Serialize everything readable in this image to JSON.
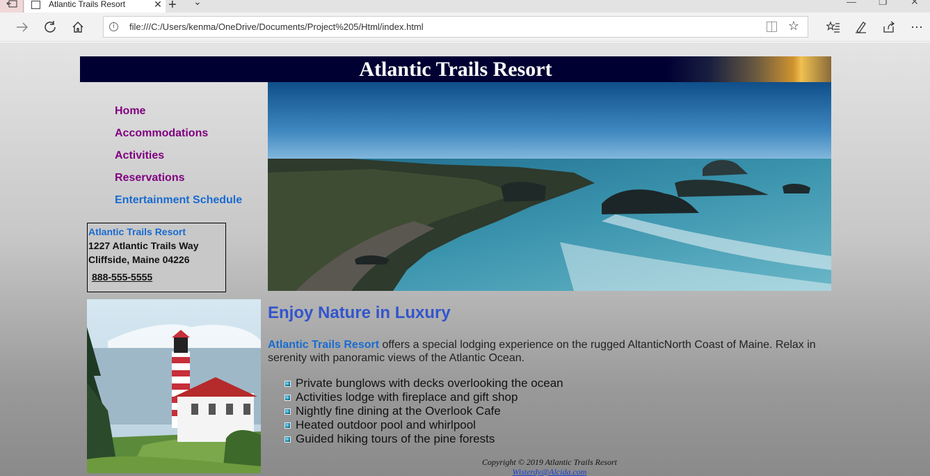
{
  "browser": {
    "tab_title": "Atlantic Trails Resort",
    "url": "file:///C:/Users/kenma/OneDrive/Documents/Project%205/Html/index.html"
  },
  "page": {
    "banner_title": "Atlantic Trails Resort",
    "nav": [
      {
        "label": "Home"
      },
      {
        "label": "Accommodations"
      },
      {
        "label": "Activities"
      },
      {
        "label": "Reservations"
      },
      {
        "label": "Entertainment Schedule"
      }
    ],
    "contact": {
      "name": "Atlantic Trails Resort",
      "street": "1227 Atlantic Trails Way",
      "city": "Cliffside, Maine 04226",
      "phone": "888-555-5555"
    },
    "heading": "Enjoy Nature in Luxury",
    "intro_name": "Atlantic Trails Resort",
    "intro_text": " offers a special lodging experience on the rugged AltanticNorth Coast of Maine. Relax in serenity with panoramic views of the Atlantic Ocean.",
    "features": [
      "Private bunglows with decks overlooking the ocean",
      "Activities lodge with fireplace and gift shop",
      "Nightly fine dining at the Overlook Cafe",
      "Heated outdoor pool and whirlpool",
      "Guided hiking tours of the pine forests"
    ],
    "footer": {
      "copyright": "Copyright © 2019 Atlantic Trails Resort",
      "email": "Wisterdy@Alcida.com"
    }
  }
}
